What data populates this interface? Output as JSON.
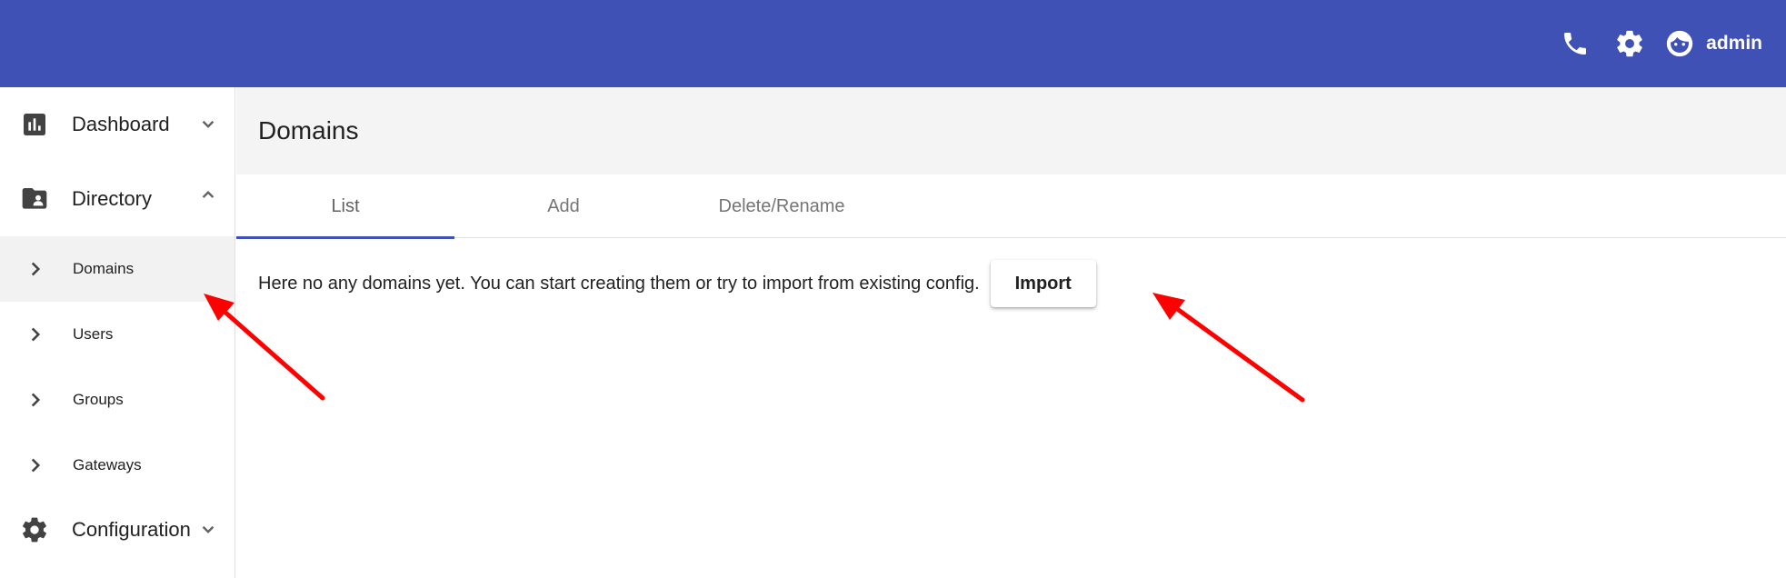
{
  "appbar": {
    "background": "#3f51b5",
    "user_name": "admin",
    "icons": [
      "phone-icon",
      "gear-icon",
      "face-icon"
    ]
  },
  "sidebar": {
    "groups": [
      {
        "label": "Dashboard",
        "icon": "bar-chart-icon",
        "expanded": false
      },
      {
        "label": "Directory",
        "icon": "folder-user-icon",
        "expanded": true
      },
      {
        "label": "Configuration",
        "icon": "gear-icon",
        "expanded": false
      }
    ],
    "directory_items": [
      {
        "label": "Domains",
        "active": true
      },
      {
        "label": "Users",
        "active": false
      },
      {
        "label": "Groups",
        "active": false
      },
      {
        "label": "Gateways",
        "active": false
      }
    ]
  },
  "main": {
    "title": "Domains",
    "tabs": [
      {
        "label": "List",
        "active": true
      },
      {
        "label": "Add",
        "active": false
      },
      {
        "label": "Delete/Rename",
        "active": false
      }
    ],
    "message": "Here no any domains yet. You can start creating them or try to import from existing config.",
    "import_label": "Import"
  },
  "annotations": {
    "arrow_color": "#ff0000"
  }
}
